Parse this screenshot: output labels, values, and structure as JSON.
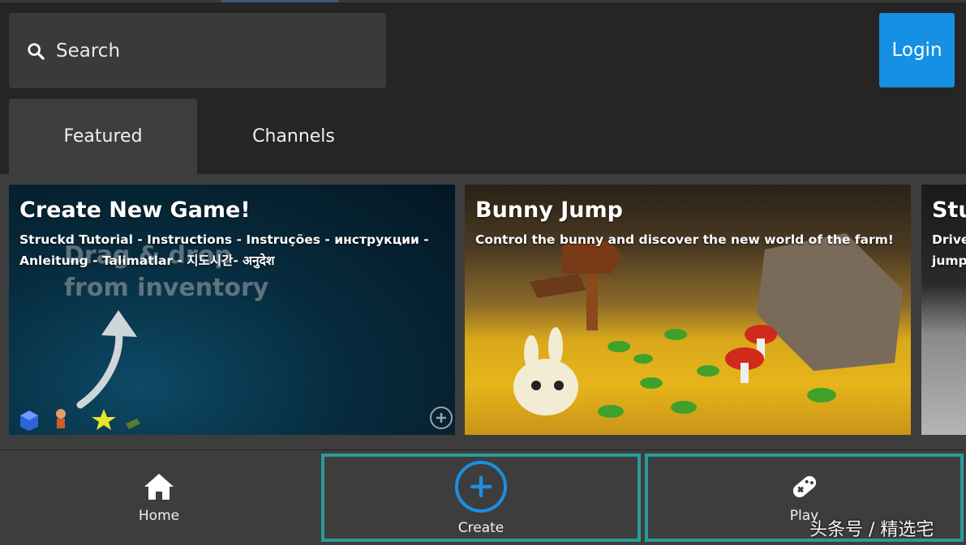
{
  "search": {
    "placeholder": "Search",
    "value": ""
  },
  "header": {
    "login_label": "Login"
  },
  "tabs": [
    {
      "label": "Featured",
      "active": true
    },
    {
      "label": "Channels",
      "active": false
    }
  ],
  "cards": [
    {
      "title": "Create New Game!",
      "description": "Struckd Tutorial - Instructions - Instruções - инструкции - Anleitung - Talimatlar - 지도시간- अनुदेश",
      "overlay_text_line1": "Drag & drop",
      "overlay_text_line2": "from inventory"
    },
    {
      "title": "Bunny Jump",
      "description": "Control the bunny and discover the new world of the farm!"
    },
    {
      "title": "Stu",
      "description": "Drive\njump"
    }
  ],
  "bottom_nav": [
    {
      "label": "Home",
      "icon": "home-icon"
    },
    {
      "label": "Create",
      "icon": "plus-circle-icon"
    },
    {
      "label": "Play",
      "icon": "gamepad-icon"
    }
  ],
  "watermark": "头条号 / 精选宅",
  "colors": {
    "accent": "#1690e3",
    "selection": "#2b9a9a",
    "panel": "#3d3d3d",
    "background": "#252525"
  }
}
